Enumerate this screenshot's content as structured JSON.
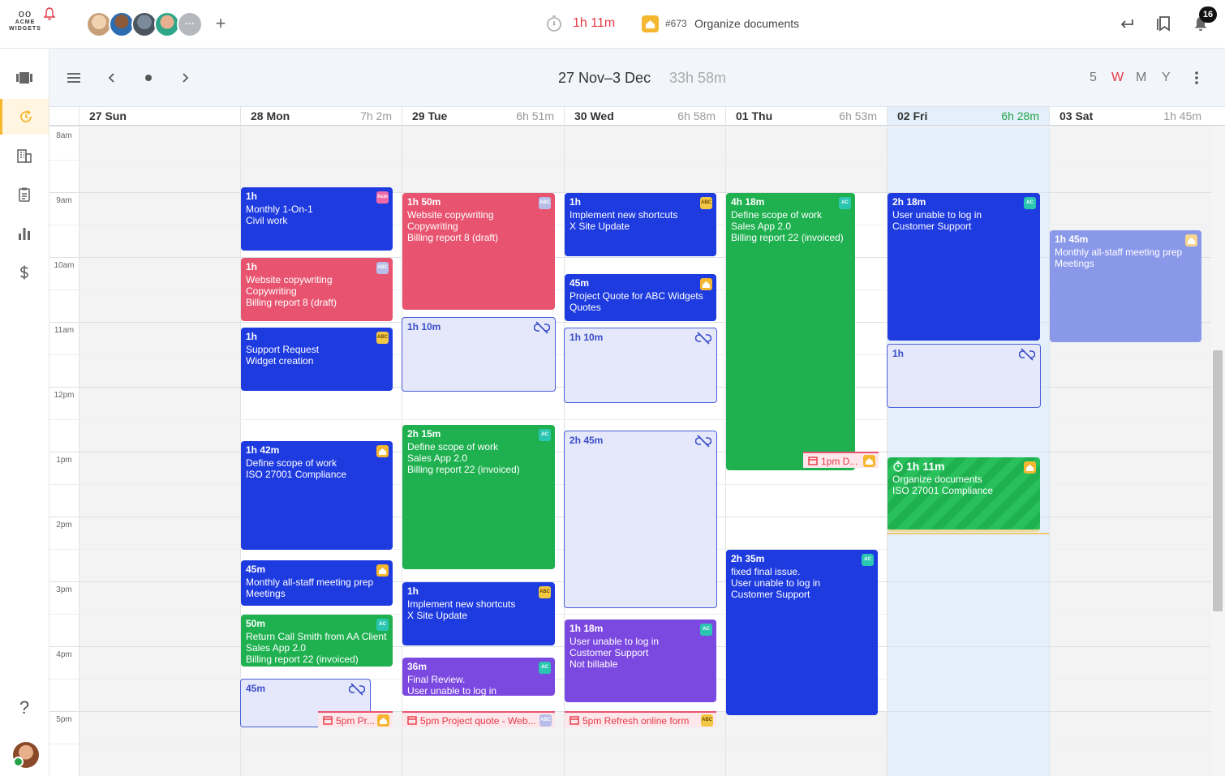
{
  "brand": {
    "eyes": "oo",
    "name": "ACME WIDGETS"
  },
  "team": {
    "more_label": "···",
    "add_label": "+"
  },
  "timer": {
    "elapsed": "1h 11m",
    "task_number": "#673",
    "task_name": "Organize documents"
  },
  "notifications": {
    "count": "16"
  },
  "toolbar": {
    "range": "27 Nov–3 Dec",
    "total": "33h 58m",
    "views": [
      "5",
      "W",
      "M",
      "Y"
    ],
    "active_view": "W"
  },
  "days": [
    {
      "name": "27 Sun",
      "total": ""
    },
    {
      "name": "28 Mon",
      "total": "7h 2m"
    },
    {
      "name": "29 Tue",
      "total": "6h 51m"
    },
    {
      "name": "30 Wed",
      "total": "6h 58m"
    },
    {
      "name": "01 Thu",
      "total": "6h 53m"
    },
    {
      "name": "02 Fri",
      "total": "6h 28m"
    },
    {
      "name": "03 Sat",
      "total": "1h 45m"
    }
  ],
  "hours": [
    "8am",
    "9am",
    "10am",
    "11am",
    "12pm",
    "1pm",
    "2pm",
    "3pm",
    "4pm",
    "5pm"
  ],
  "badges": {
    "abc": "ABC",
    "ac": "AC",
    "acm": "Acm"
  },
  "events": {
    "mon_1": {
      "duration": "1h",
      "line1": "Monthly 1-On-1",
      "line2": "Civil work"
    },
    "mon_2": {
      "duration": "1h",
      "line1": "Website copywriting",
      "line2": "Copywriting",
      "line3": "Billing report 8 (draft)"
    },
    "mon_3": {
      "duration": "1h",
      "line1": "Support Request",
      "line2": "Widget creation"
    },
    "mon_4": {
      "duration": "1h 42m",
      "line1": "Define scope of work",
      "line2": "ISO 27001 Compliance"
    },
    "mon_5": {
      "duration": "45m",
      "line1": "Monthly all-staff meeting prep",
      "line2": "Meetings"
    },
    "mon_6": {
      "duration": "50m",
      "line1": "Return Call Smith from AA Client",
      "line2": "Sales App 2.0",
      "line3": "Billing report 22 (invoiced)"
    },
    "mon_gap": {
      "duration": "45m"
    },
    "tue_1": {
      "duration": "1h 50m",
      "line1": "Website copywriting",
      "line2": "Copywriting",
      "line3": "Billing report 8 (draft)"
    },
    "tue_gap": {
      "duration": "1h 10m"
    },
    "tue_2": {
      "duration": "2h 15m",
      "line1": "Define scope of work",
      "line2": "Sales App 2.0",
      "line3": "Billing report 22 (invoiced)"
    },
    "tue_3": {
      "duration": "1h",
      "line1": "Implement new shortcuts",
      "line2": "X Site Update"
    },
    "tue_4": {
      "duration": "36m",
      "line1": "Final Review.",
      "line2": "User unable to log in"
    },
    "wed_1": {
      "duration": "1h",
      "line1": "Implement new shortcuts",
      "line2": "X Site Update"
    },
    "wed_2": {
      "duration": "45m",
      "line1": "Project Quote for ABC Widgets",
      "line2": "Quotes"
    },
    "wed_gap1": {
      "duration": "1h 10m"
    },
    "wed_gap2": {
      "duration": "2h 45m"
    },
    "wed_3": {
      "duration": "1h 18m",
      "line1": "User unable to log in",
      "line2": "Customer Support",
      "line3": "Not billable"
    },
    "thu_1": {
      "duration": "4h 18m",
      "line1": "Define scope of work",
      "line2": "Sales App 2.0",
      "line3": "Billing report 22 (invoiced)"
    },
    "thu_2": {
      "duration": "2h 35m",
      "line1": "fixed final issue.",
      "line2": "User unable to log in",
      "line3": "Customer Support"
    },
    "fri_1": {
      "duration": "2h 18m",
      "line1": "User unable to log in",
      "line2": "Customer Support"
    },
    "fri_gap": {
      "duration": "1h"
    },
    "fri_running": {
      "duration": "1h 11m",
      "line1": "Organize documents",
      "line2": "ISO 27001 Compliance"
    },
    "sat_1": {
      "duration": "1h 45m",
      "line1": "Monthly all-staff meeting prep",
      "line2": "Meetings"
    }
  },
  "deadlines": {
    "thu": "1pm D...",
    "mon": "5pm Pr...",
    "tue": "5pm Project quote - Web...",
    "wed": "5pm Refresh online form"
  },
  "help_label": "?"
}
